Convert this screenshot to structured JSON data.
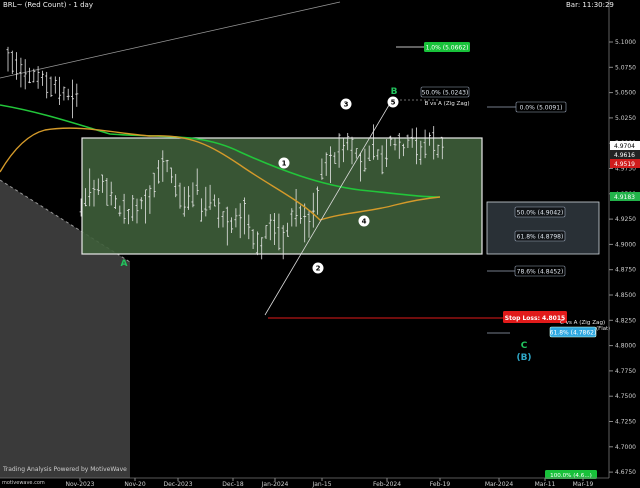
{
  "header": {
    "title": "BRL~ (Red Count) - 1 day",
    "bar_time": "Bar: 11:30:29"
  },
  "footer": {
    "credit": "Trading Analysis Powered by MotiveWave",
    "site": "motivewave.com"
  },
  "axis": {
    "price_ticks": [
      "5.1000",
      "5.0750",
      "5.0500",
      "5.0250",
      "5.0000",
      "4.9750",
      "4.9500",
      "4.9250",
      "4.9000",
      "4.8750",
      "4.8500",
      "4.8250",
      "4.8000",
      "4.7750",
      "4.7500",
      "4.7250",
      "4.7000",
      "4.6750",
      "4.6500"
    ],
    "date_ticks": [
      "Nov-2023",
      "Nov-20",
      "Dec-2023",
      "Dec-18",
      "Jan-2024",
      "Jan-15",
      "Feb-2024",
      "Feb-19",
      "Mar-2024",
      "Mar-11",
      "Mar-19"
    ],
    "price_tags": [
      {
        "text": "4.9704",
        "bg": "#ffffff",
        "fg": "#000000"
      },
      {
        "text": "4.9616",
        "bg": "#222222",
        "fg": "#ffffff"
      },
      {
        "text": "4.9519",
        "bg": "#d01c1c",
        "fg": "#ffffff"
      },
      {
        "text": "4.9183",
        "bg": "#22b34a",
        "fg": "#ffffff"
      }
    ]
  },
  "waves": {
    "A": "A",
    "B": "B",
    "C": "C",
    "C_alt": "(B)",
    "n1": "1",
    "n2": "2",
    "n3": "3",
    "n4": "4",
    "n5": "5"
  },
  "annotations": {
    "fib_top": "1.0% (5.0662)",
    "fib_b": "50.0% (5.0243)",
    "b_vs_a": "B vs A (Zig Zag)",
    "fib_0": "0.0% (5.0091)",
    "fib_50": "50.0% (4.9042)",
    "fib_618": "61.8% (4.8798)",
    "fib_786": "78.6% (4.8452)",
    "stop_loss": "Stop Loss: 4.8015",
    "c_vs_a": "C vs A (Zig Zag)",
    "c_flat": "(Flat)",
    "fib_c": "61.8% (4.7862)",
    "fib_bottom": "100.0% (4.6...)"
  },
  "colors": {
    "background": "#000000",
    "box": "#3e5e3a",
    "ma_green": "#22c53a",
    "ma_orange": "#d49a2a",
    "wave_green": "#22c55e",
    "wave_cyan": "#2fa8c8",
    "stop": "#e11a1a"
  },
  "chart_data": {
    "type": "candlestick",
    "symbol": "BRL~",
    "timeframe": "1 day",
    "y_axis_range": [
      4.65,
      5.11
    ],
    "levels": [
      {
        "label": "Stop Loss",
        "value": 4.8015
      },
      {
        "label": "78.6%",
        "value": 4.8452
      },
      {
        "label": "61.8%",
        "value": 4.8798
      },
      {
        "label": "50.0%",
        "value": 4.9042
      },
      {
        "label": "0.0%",
        "value": 5.0091
      },
      {
        "label": "50.0% B",
        "value": 5.0243
      },
      {
        "label": "61.8% C",
        "value": 4.7862
      }
    ]
  }
}
